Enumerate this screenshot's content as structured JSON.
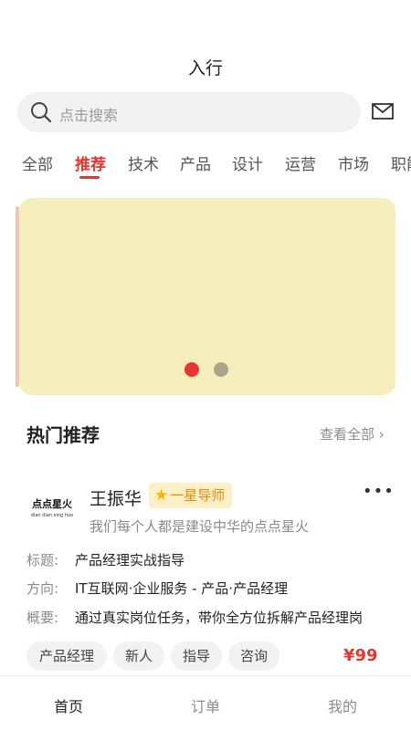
{
  "header": {
    "title": "入行"
  },
  "search": {
    "placeholder": "点击搜索"
  },
  "icons": {
    "search": "search-icon",
    "mail": "mail-icon",
    "more": "more-icon",
    "star": "star-icon"
  },
  "tabs": [
    {
      "label": "全部",
      "active": false
    },
    {
      "label": "推荐",
      "active": true
    },
    {
      "label": "技术",
      "active": false
    },
    {
      "label": "产品",
      "active": false
    },
    {
      "label": "设计",
      "active": false
    },
    {
      "label": "运营",
      "active": false
    },
    {
      "label": "市场",
      "active": false
    },
    {
      "label": "职能",
      "active": false
    }
  ],
  "banner": {
    "color": "#f6efbd",
    "slide_count": 2,
    "active_slide": 1
  },
  "hot_section": {
    "title": "热门推荐",
    "see_all": "查看全部 ›"
  },
  "mentor_card": {
    "avatar_text": "点点星火",
    "avatar_subtext": "dian dian xing huo",
    "name": "王振华",
    "badge": "一星导师",
    "tagline": "我们每个人都是建设中华的点点星火",
    "title_label": "标题:",
    "title_value": "产品经理实战指导",
    "direction_label": "方向:",
    "direction_value": "IT互联网·企业服务 - 产品·产品经理",
    "summary_label": "概要:",
    "summary_value": "通过真实岗位任务，带你全方位拆解产品经理岗",
    "tags": [
      "产品经理",
      "新人",
      "指导",
      "咨询"
    ],
    "price": "¥99"
  },
  "bottom_nav": [
    {
      "label": "首页",
      "active": true
    },
    {
      "label": "订单",
      "active": false
    },
    {
      "label": "我的",
      "active": false
    }
  ],
  "colors": {
    "accent": "#e8352f",
    "dot_active": "#e8352f",
    "dot_inactive": "#a9a68a"
  }
}
